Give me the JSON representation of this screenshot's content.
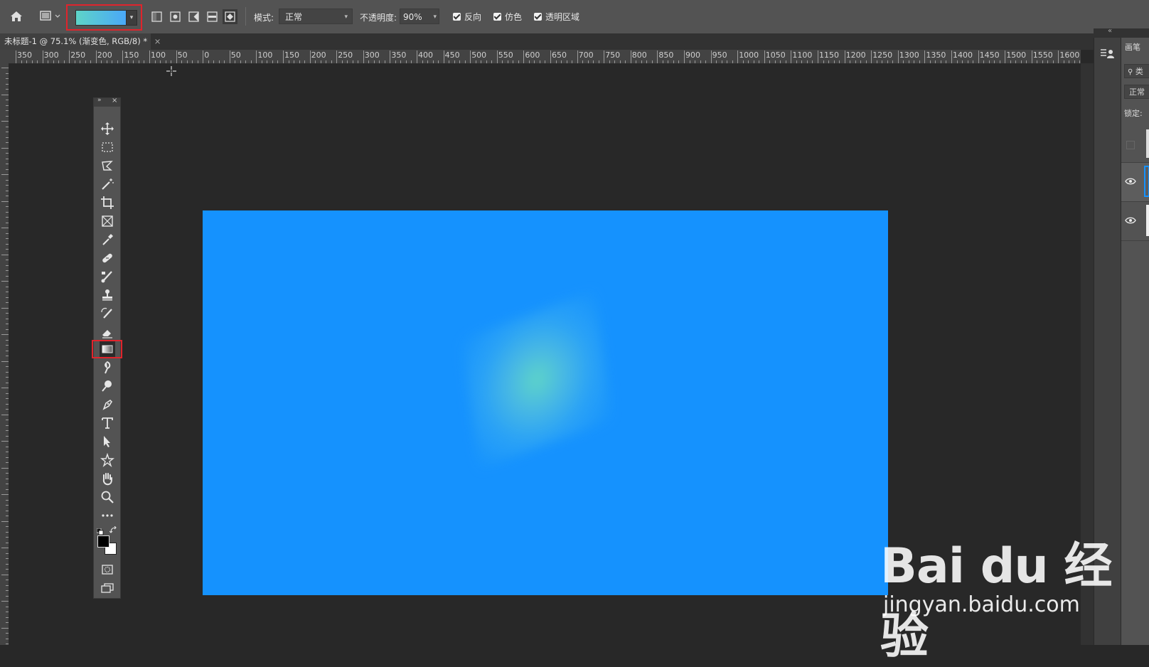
{
  "options_bar": {
    "mode_label": "模式:",
    "mode_value": "正常",
    "opacity_label": "不透明度:",
    "opacity_value": "90%",
    "reverse_label": "反向",
    "dither_label": "仿色",
    "transparency_label": "透明区域"
  },
  "document_tab": {
    "title": "未标题-1 @ 75.1% (渐变色, RGB/8) *",
    "close": "×"
  },
  "ruler": {
    "labels": [
      "350",
      "300",
      "250",
      "200",
      "150",
      "100",
      "50",
      "0",
      "50",
      "100",
      "150",
      "200",
      "250",
      "300",
      "350",
      "400",
      "450",
      "500",
      "550",
      "600",
      "650",
      "700",
      "750",
      "800",
      "850",
      "900",
      "950",
      "1000",
      "1050",
      "1100",
      "1150",
      "1200",
      "1250",
      "1300",
      "1350",
      "1400",
      "1450",
      "1500",
      "1550",
      "1600"
    ]
  },
  "right_panel": {
    "header": "画笔",
    "search_text": "类",
    "blend_mode": "正常",
    "lock_label": "锁定:"
  },
  "watermark": {
    "line1": "Bai du 经验",
    "line2": "jingyan.baidu.com"
  },
  "colors": {
    "canvas_fill": "#1592fe",
    "gradient_start": "#5ed4c8",
    "gradient_end": "#4aa8f8",
    "highlight_box": "#e0242c"
  }
}
